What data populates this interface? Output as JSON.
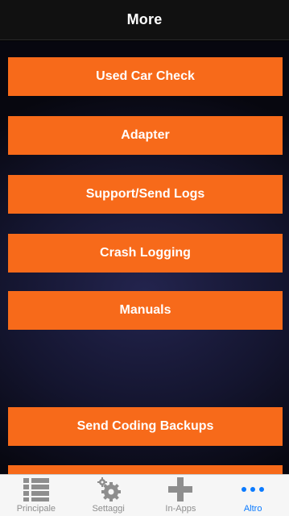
{
  "nav": {
    "title": "More"
  },
  "menu": {
    "items": [
      {
        "label": "Used Car Check"
      },
      {
        "label": "Adapter"
      },
      {
        "label": "Support/Send Logs"
      },
      {
        "label": "Crash Logging"
      },
      {
        "label": "Manuals"
      },
      {
        "label": "Send Coding Backups"
      }
    ],
    "button_color": "#f76a1a"
  },
  "tabs": [
    {
      "label": "Principale",
      "icon": "list-icon"
    },
    {
      "label": "Settaggi",
      "icon": "gear-icon"
    },
    {
      "label": "In-Apps",
      "icon": "plus-icon"
    },
    {
      "label": "Altro",
      "icon": "more-dots-icon",
      "active": true
    }
  ],
  "colors": {
    "active_tab": "#0a7aff",
    "inactive_tab": "#8e8e8e"
  }
}
